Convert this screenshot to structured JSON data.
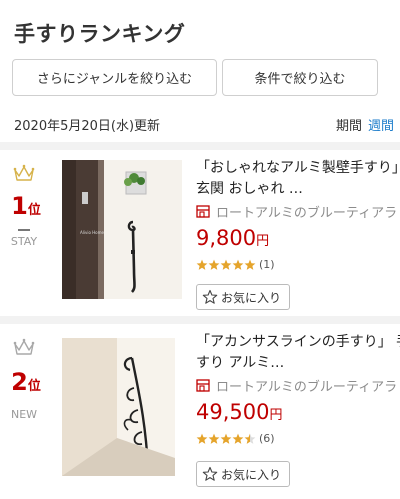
{
  "header": {
    "title": "手すりランキング",
    "filter_genre_label": "さらにジャンルを絞り込む",
    "filter_condition_label": "条件で絞り込む",
    "update_date": "2020年5月20日(水)更新",
    "period_label": "期間",
    "period_active": "週間"
  },
  "items": [
    {
      "rank": "1",
      "rank_suffix": "位",
      "rank_change": "STAY",
      "name": "「おしゃれなアルミ製壁手すり」 玄関 おしゃれ …",
      "shop": "ロートアルミのブルーティアラ",
      "price": "9,800",
      "price_unit": "円",
      "rating": 5,
      "review_count": "(1)",
      "fav_label": "お気に入り",
      "crown_color": "#d6b24a"
    },
    {
      "rank": "2",
      "rank_suffix": "位",
      "rank_change": "NEW",
      "name": "「アカンサスラインの手すり」 手すり アルミ…",
      "shop": "ロートアルミのブルーティアラ",
      "price": "49,500",
      "price_unit": "円",
      "rating": 4.5,
      "review_count": "(6)",
      "fav_label": "お気に入り",
      "crown_color": "#a8a8a8"
    }
  ],
  "colors": {
    "accent_red": "#bf0000",
    "link_blue": "#1f7ecb",
    "star": "#e5a42b"
  },
  "icons": [
    "crown-icon",
    "shop-icon",
    "star-icon",
    "star-outline-icon"
  ]
}
